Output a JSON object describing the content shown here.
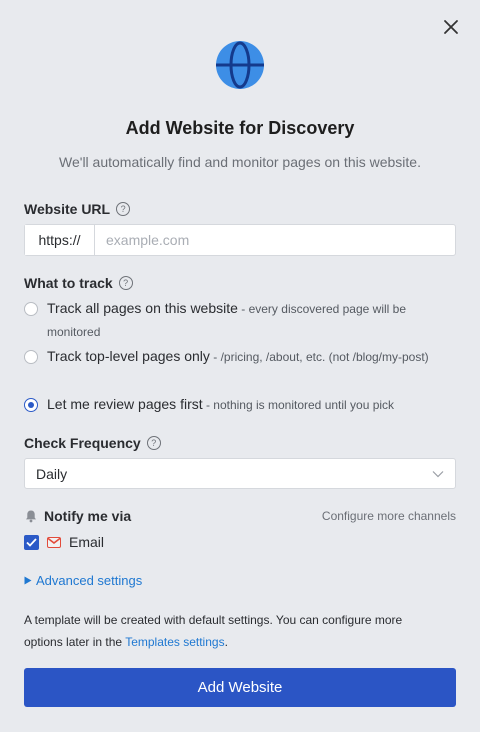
{
  "dialog": {
    "title": "Add Website for Discovery",
    "subtitle": "We'll automatically find and monitor pages on this website."
  },
  "url": {
    "label": "Website URL",
    "prefix": "https://",
    "placeholder": "example.com",
    "value": ""
  },
  "track": {
    "label": "What to track",
    "options": [
      {
        "label": "Track all pages on this website",
        "desc": " - every discovered page will be monitored",
        "checked": false
      },
      {
        "label": "Track top-level pages only",
        "desc": " - /pricing, /about, etc. (not /blog/my-post)",
        "checked": false
      },
      {
        "label": "Let me review pages first",
        "desc": " - nothing is monitored until you pick",
        "checked": true
      }
    ]
  },
  "frequency": {
    "label": "Check Frequency",
    "selected": "Daily"
  },
  "notify": {
    "label": "Notify me via",
    "configure": "Configure more channels",
    "email_label": "Email",
    "email_checked": true
  },
  "advanced_label": "Advanced settings",
  "note": {
    "text_before": "A template will be created with default settings. You can configure more options later in the ",
    "link": "Templates settings",
    "text_after": "."
  },
  "submit_label": "Add Website",
  "colors": {
    "primary": "#2b55c5",
    "link": "#1f78d1",
    "background": "#e8eaee"
  }
}
